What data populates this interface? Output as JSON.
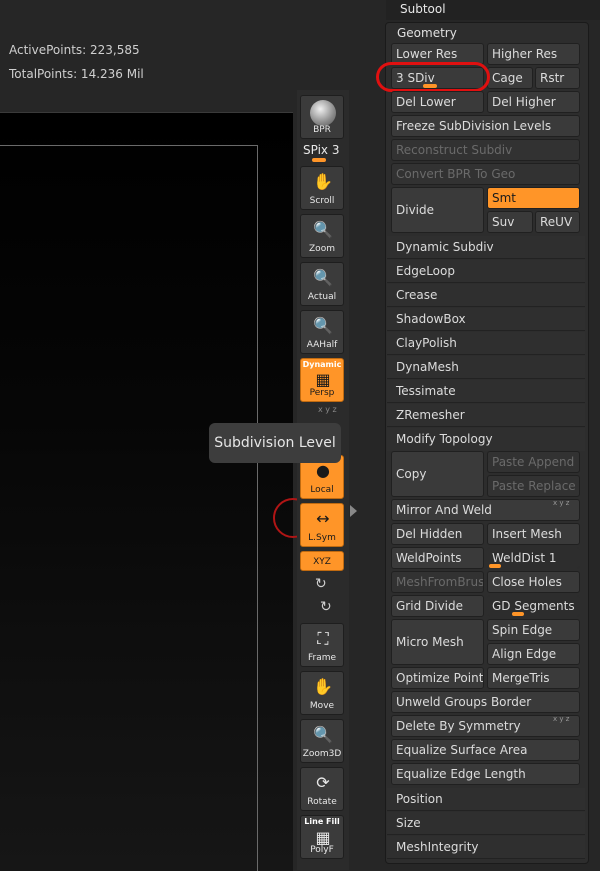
{
  "stats": {
    "active_points": "ActivePoints: 223,585",
    "total_points": "TotalPoints: 14.236 Mil"
  },
  "tooltip": "Subdivision Level",
  "shelf": {
    "bpr": "BPR",
    "spix": "SPix 3",
    "scroll": "Scroll",
    "zoom": "Zoom",
    "actual": "Actual",
    "aahalf": "AAHalf",
    "dynamic": "Dynamic",
    "persp": "Persp",
    "local": "Local",
    "lsym": "L.Sym",
    "xyz": "XYZ",
    "frame": "Frame",
    "move": "Move",
    "zoom3d": "Zoom3D",
    "rotate": "Rotate",
    "linefill": "Line Fill",
    "polyf": "PolyF"
  },
  "panel": {
    "subtool": "Subtool",
    "geometry": "Geometry",
    "lower_res": "Lower Res",
    "higher_res": "Higher Res",
    "sdiv": "3 SDiv",
    "cage": "Cage",
    "rstr": "Rstr",
    "del_lower": "Del Lower",
    "del_higher": "Del Higher",
    "freeze": "Freeze SubDivision Levels",
    "reconstruct": "Reconstruct Subdiv",
    "convert_bpr": "Convert BPR To Geo",
    "divide": "Divide",
    "smt": "Smt",
    "suv": "Suv",
    "reuv": "ReUV",
    "dynamic_subdiv": "Dynamic Subdiv",
    "edgeloop": "EdgeLoop",
    "crease": "Crease",
    "shadowbox": "ShadowBox",
    "claypolish": "ClayPolish",
    "dynamesh": "DynaMesh",
    "tessimate": "Tessimate",
    "zremesher": "ZRemesher",
    "modify_topology": "Modify Topology",
    "copy": "Copy",
    "paste_append": "Paste Append",
    "paste_replace": "Paste Replace",
    "mirror_weld": "Mirror And Weld",
    "del_hidden": "Del Hidden",
    "insert_mesh": "Insert Mesh",
    "weldpoints": "WeldPoints",
    "welddist": "WeldDist 1",
    "meshfrombrush": "MeshFromBrush",
    "close_holes": "Close Holes",
    "grid_divide": "Grid Divide",
    "gd_segments": "GD Segments 3",
    "micro_mesh": "Micro Mesh",
    "spin_edge": "Spin Edge",
    "align_edge": "Align Edge",
    "optimize_points": "Optimize Points",
    "mergetris": "MergeTris",
    "unweld_groups": "Unweld Groups Border",
    "del_symmetry": "Delete By Symmetry",
    "equalize_surface": "Equalize Surface Area",
    "equalize_edge": "Equalize Edge Length",
    "position": "Position",
    "size": "Size",
    "meshintegrity": "MeshIntegrity"
  },
  "colors": {
    "accent": "#ff9528",
    "annotation": "#e01010"
  }
}
